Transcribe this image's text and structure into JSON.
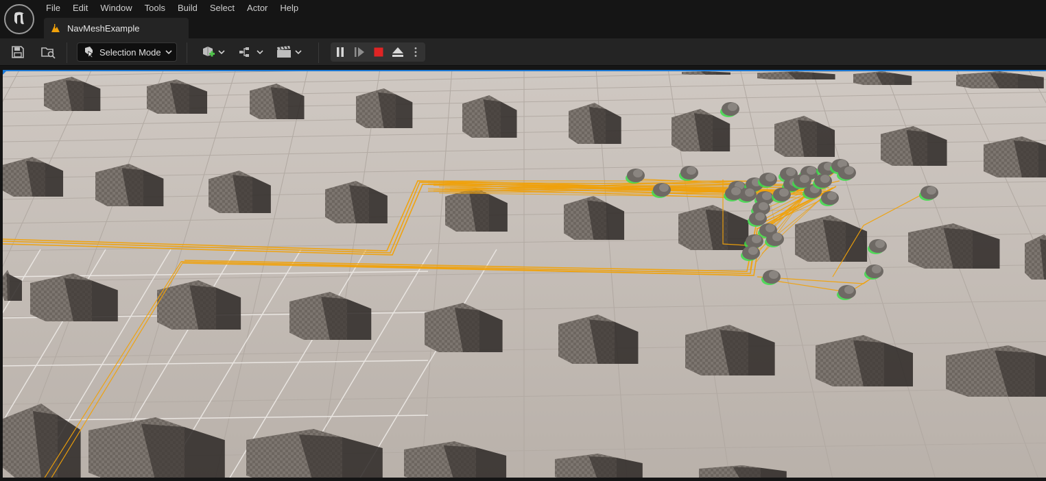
{
  "app": {
    "logo_icon": "unreal-engine-logo-icon",
    "menu": [
      "File",
      "Edit",
      "Window",
      "Tools",
      "Build",
      "Select",
      "Actor",
      "Help"
    ]
  },
  "tab": {
    "label": "NavMeshExample",
    "icon": "level-map-icon"
  },
  "toolbar": {
    "save_icon": "save-icon",
    "browse_icon": "content-browser-icon",
    "mode_label": "Selection Mode",
    "add_icon": "add-actor-icon",
    "blueprint_icon": "blueprint-icon",
    "cinematics_icon": "cinematics-icon",
    "pause_icon": "pause-icon",
    "step_icon": "frame-step-icon",
    "stop_icon": "stop-icon",
    "eject_icon": "eject-icon",
    "more_icon": "more-options-icon"
  },
  "colors": {
    "accent": "#1a78d6",
    "path": "#f0a10a",
    "agent_outline": "#3ddc4a",
    "stop": "#e02424"
  },
  "viewport": {
    "scene": "navmesh-agents-scene"
  }
}
